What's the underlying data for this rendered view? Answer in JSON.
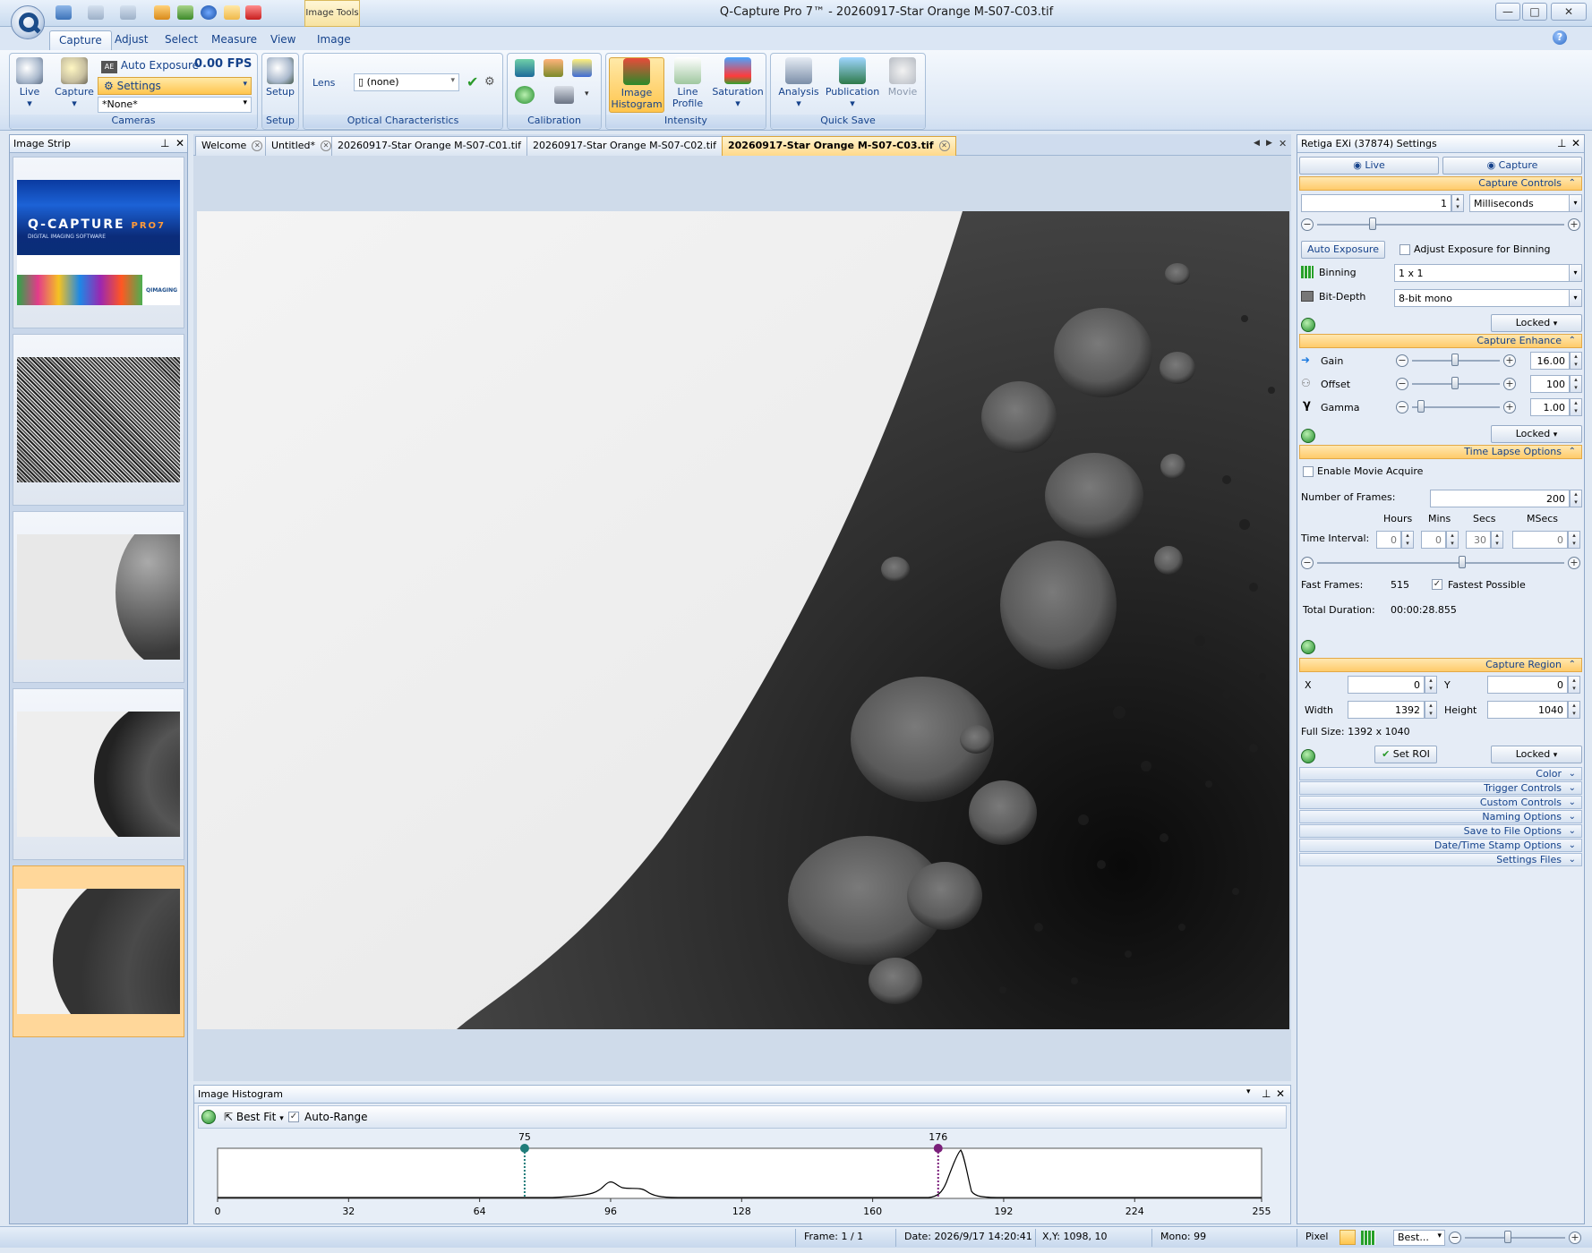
{
  "window": {
    "title": "Q-Capture Pro 7™ - 20260917-Star Orange M-S07-C03.tif",
    "context_tab": "Image Tools",
    "min_glyph": "—",
    "max_glyph": "□",
    "close_glyph": "✕"
  },
  "ribbon_tabs": [
    "Capture",
    "Adjust",
    "Select",
    "Measure",
    "View",
    "Image"
  ],
  "ribbon": {
    "cameras": {
      "label": "Cameras",
      "live": "Live",
      "capture": "Capture",
      "auto_exposure": "Auto Exposure",
      "fps": "0.00 FPS",
      "settings": "Settings",
      "preset": "*None*"
    },
    "setup": {
      "label": "Setup",
      "button": "Setup"
    },
    "optical": {
      "label": "Optical Characteristics",
      "lens_label": "Lens",
      "lens_value": "(none)"
    },
    "calibration": {
      "label": "Calibration"
    },
    "intensity": {
      "label": "Intensity",
      "image_histogram_1": "Image",
      "image_histogram_2": "Histogram",
      "line_profile_1": "Line",
      "line_profile_2": "Profile",
      "saturation": "Saturation"
    },
    "quicksave": {
      "label": "Quick Save",
      "analysis": "Analysis",
      "publication": "Publication",
      "movie": "Movie"
    }
  },
  "image_strip": {
    "title": "Image Strip",
    "splash_logo": "Q-CAPTURE",
    "splash_logo_suffix": "PRO7",
    "splash_subtitle": "DIGITAL IMAGING SOFTWARE",
    "splash_brand": "QIMAGING"
  },
  "doc_tabs": [
    {
      "label": "Welcome"
    },
    {
      "label": "Untitled*"
    },
    {
      "label": "20260917-Star Orange M-S07-C01.tif"
    },
    {
      "label": "20260917-Star Orange M-S07-C02.tif"
    },
    {
      "label": "20260917-Star Orange M-S07-C03.tif"
    }
  ],
  "histogram": {
    "title": "Image Histogram",
    "fit": "Best Fit",
    "auto_range": "Auto-Range",
    "low_marker": 75,
    "high_marker": 176,
    "ticks": [
      0,
      32,
      64,
      96,
      128,
      160,
      192,
      224,
      255
    ]
  },
  "settings": {
    "title": "Retiga EXi (37874) Settings",
    "live": "Live",
    "capture": "Capture",
    "capture_controls": {
      "title": "Capture Controls",
      "exposure_value": "1",
      "exposure_unit": "Milliseconds",
      "auto_exposure_btn": "Auto Exposure",
      "adjust_binning": "Adjust Exposure for Binning",
      "binning_label": "Binning",
      "binning_value": "1 x 1",
      "bitdepth_label": "Bit-Depth",
      "bitdepth_value": "8-bit mono",
      "locked": "Locked"
    },
    "capture_enhance": {
      "title": "Capture Enhance",
      "gain_label": "Gain",
      "gain_value": "16.00",
      "offset_label": "Offset",
      "offset_value": "100",
      "gamma_label": "Gamma",
      "gamma_value": "1.00",
      "locked": "Locked"
    },
    "time_lapse": {
      "title": "Time Lapse Options",
      "enable_movie": "Enable Movie Acquire",
      "frames_label": "Number of  Frames:",
      "frames_value": "200",
      "hours": "Hours",
      "mins": "Mins",
      "secs": "Secs",
      "msecs": "MSecs",
      "interval_label": "Time Interval:",
      "hours_value": "0",
      "mins_value": "0",
      "secs_value": "30",
      "msecs_value": "0",
      "fast_frames_label": "Fast Frames:",
      "fast_frames_value": "515",
      "fastest": "Fastest Possible",
      "total_label": "Total Duration:",
      "total_value": "00:00:28.855"
    },
    "capture_region": {
      "title": "Capture Region",
      "x_label": "X",
      "x_value": "0",
      "y_label": "Y",
      "y_value": "0",
      "width_label": "Width",
      "width_value": "1392",
      "height_label": "Height",
      "height_value": "1040",
      "full_size": "Full Size: 1392 x 1040",
      "set_roi": "Set ROI",
      "locked": "Locked"
    },
    "collapsed": [
      "Color",
      "Trigger Controls",
      "Custom Controls",
      "Naming Options",
      "Save to File Options",
      "Date/Time Stamp Options",
      "Settings Files"
    ]
  },
  "status": {
    "frame": "Frame: 1 / 1",
    "date": "Date: 2026/9/17 14:20:41",
    "xy": "X,Y: 1098,    10",
    "mono": "Mono:    99",
    "pixel": "Pixel",
    "zoom": "Best..."
  },
  "colors": {
    "accent": "#ffcb6b",
    "ribbon": "#dce7f5",
    "selected": "#ffd98a"
  }
}
